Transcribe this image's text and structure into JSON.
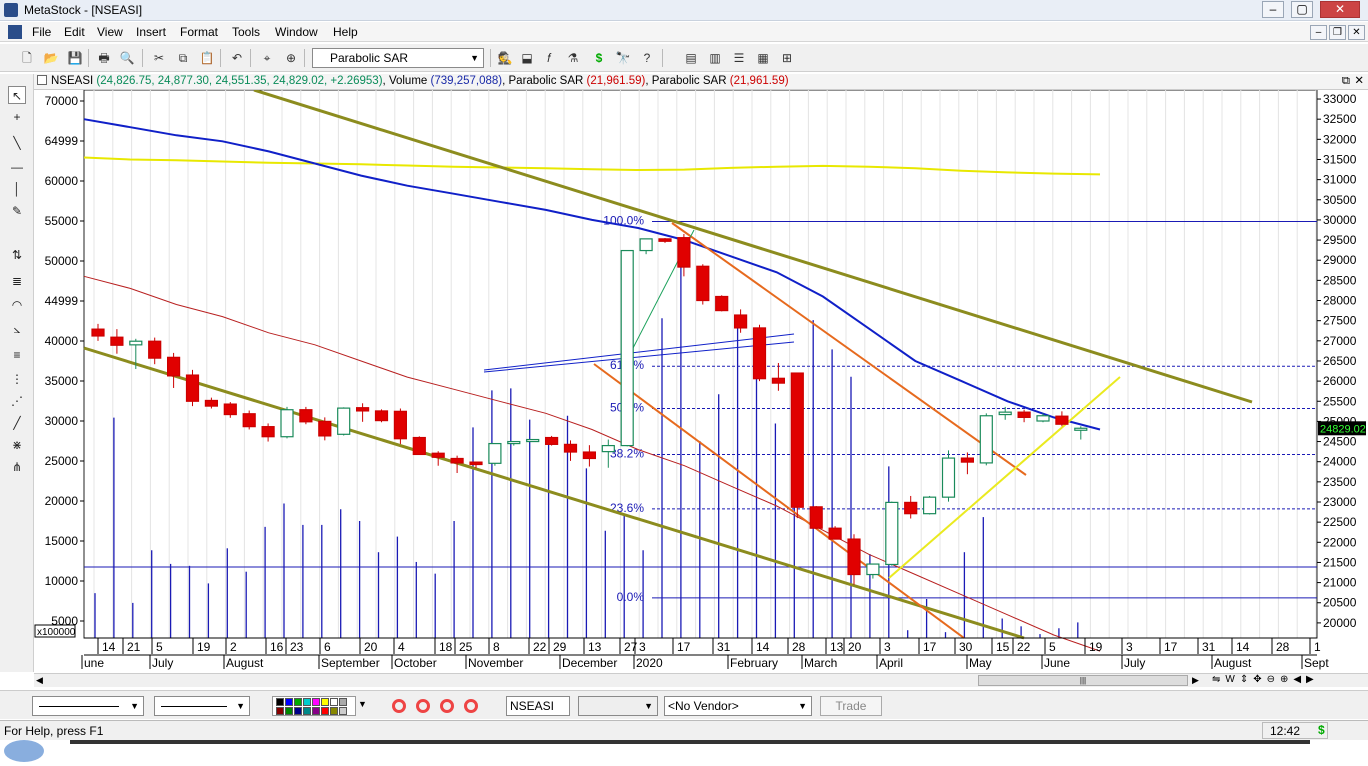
{
  "app": {
    "title": "MetaStock - [NSEASI]"
  },
  "menu": [
    "File",
    "Edit",
    "View",
    "Insert",
    "Format",
    "Tools",
    "Window",
    "Help"
  ],
  "toolbar": {
    "indicator_select": "Parabolic SAR"
  },
  "header": {
    "symbol": "NSEASI",
    "ohlc": "(24,826.75, 24,877.30, 24,551.35, 24,829.02, +2.26953)",
    "volume_label": "Volume",
    "volume_value": "(739,257,088)",
    "sar1_label": "Parabolic SAR",
    "sar1_value": "(21,961.59)",
    "sar2_label": "Parabolic SAR",
    "sar2_value": "(21,961.59)"
  },
  "chart_data": {
    "type": "candlestick",
    "left_axis": {
      "ticks": [
        "70000",
        "64999",
        "60000",
        "55000",
        "50000",
        "44999",
        "40000",
        "35000",
        "30000",
        "25000",
        "20000",
        "15000",
        "10000",
        "5000"
      ],
      "multiplier": "x100000"
    },
    "right_axis": {
      "ticks": [
        "33000",
        "32500",
        "32000",
        "31500",
        "31000",
        "30500",
        "30000",
        "29500",
        "29000",
        "28500",
        "28000",
        "27500",
        "27000",
        "26500",
        "26000",
        "25500",
        "25000",
        "24500",
        "24000",
        "23500",
        "23000",
        "22500",
        "22000",
        "21500",
        "21000",
        "20500",
        "20000"
      ],
      "ylim": [
        19625,
        33125
      ]
    },
    "last_price": "24829.02",
    "fib_labels": [
      {
        "label": "100.0%",
        "price": 29960
      },
      {
        "label": "61.8%",
        "price": 26370
      },
      {
        "label": "50.0%",
        "price": 25320
      },
      {
        "label": "38.2%",
        "price": 24180
      },
      {
        "label": "23.6%",
        "price": 22830
      },
      {
        "label": "0.0%",
        "price": 20620
      }
    ],
    "x_day_labels": [
      "14",
      "21",
      "5",
      "19",
      "2",
      "16",
      "23",
      "6",
      "20",
      "4",
      "18",
      "25",
      "8",
      "22",
      "29",
      "13",
      "27",
      "3",
      "17",
      "31",
      "14",
      "28",
      "13",
      "20",
      "3",
      "17",
      "30",
      "15",
      "22",
      "5",
      "19",
      "3",
      "17",
      "31",
      "14",
      "28",
      "1"
    ],
    "x_month_labels": [
      "une",
      "July",
      "August",
      "September",
      "October",
      "November",
      "December",
      "2020",
      "February",
      "March",
      "April",
      "May",
      "June",
      "July",
      "August",
      "Sept"
    ],
    "candles": [
      {
        "o": 27290,
        "h": 27420,
        "c": 27120,
        "l": 27000
      },
      {
        "o": 27090,
        "h": 27290,
        "c": 26890,
        "l": 26680
      },
      {
        "o": 26900,
        "h": 27050,
        "c": 26990,
        "l": 26300
      },
      {
        "o": 26990,
        "h": 27080,
        "c": 26570,
        "l": 26420
      },
      {
        "o": 26590,
        "h": 26700,
        "c": 26130,
        "l": 25830
      },
      {
        "o": 26150,
        "h": 26280,
        "c": 25500,
        "l": 25380
      },
      {
        "o": 25520,
        "h": 25590,
        "c": 25380,
        "l": 25320
      },
      {
        "o": 25430,
        "h": 25480,
        "c": 25170,
        "l": 25090
      },
      {
        "o": 25190,
        "h": 25270,
        "c": 24870,
        "l": 24800
      },
      {
        "o": 24870,
        "h": 24950,
        "c": 24620,
        "l": 24500
      },
      {
        "o": 24620,
        "h": 25360,
        "c": 25290,
        "l": 24580
      },
      {
        "o": 25290,
        "h": 25360,
        "c": 24990,
        "l": 24930
      },
      {
        "o": 25000,
        "h": 25100,
        "c": 24640,
        "l": 24530
      },
      {
        "o": 24680,
        "h": 25350,
        "c": 25330,
        "l": 24650
      },
      {
        "o": 25340,
        "h": 25450,
        "c": 25260,
        "l": 24990
      },
      {
        "o": 25260,
        "h": 25300,
        "c": 25020,
        "l": 24980
      },
      {
        "o": 25250,
        "h": 25320,
        "c": 24570,
        "l": 24440
      },
      {
        "o": 24600,
        "h": 24630,
        "c": 24180,
        "l": 24180
      },
      {
        "o": 24210,
        "h": 24260,
        "c": 24110,
        "l": 23900
      },
      {
        "o": 24080,
        "h": 24150,
        "c": 23970,
        "l": 23720
      },
      {
        "o": 23990,
        "h": 24000,
        "c": 23930,
        "l": 23840
      },
      {
        "o": 23960,
        "h": 24390,
        "c": 24450,
        "l": 23900
      },
      {
        "o": 24450,
        "h": 24510,
        "c": 24500,
        "l": 24400
      },
      {
        "o": 24530,
        "h": 24560,
        "c": 24550,
        "l": 24490
      },
      {
        "o": 24600,
        "h": 24640,
        "c": 24430,
        "l": 24400
      },
      {
        "o": 24430,
        "h": 24530,
        "c": 24240,
        "l": 24020
      },
      {
        "o": 24240,
        "h": 24410,
        "c": 24080,
        "l": 23880
      },
      {
        "o": 24250,
        "h": 24550,
        "c": 24400,
        "l": 23850
      },
      {
        "o": 24400,
        "h": 28720,
        "c": 29240,
        "l": 24380
      },
      {
        "o": 29240,
        "h": 29420,
        "c": 29530,
        "l": 29150
      },
      {
        "o": 29530,
        "h": 29550,
        "c": 29470,
        "l": 29430
      },
      {
        "o": 29560,
        "h": 29650,
        "c": 28830,
        "l": 28600
      },
      {
        "o": 28850,
        "h": 28900,
        "c": 28000,
        "l": 27900
      },
      {
        "o": 28100,
        "h": 28130,
        "c": 27750,
        "l": 27730
      },
      {
        "o": 27640,
        "h": 27780,
        "c": 27320,
        "l": 27200
      },
      {
        "o": 27320,
        "h": 27400,
        "c": 26060,
        "l": 26000
      },
      {
        "o": 26070,
        "h": 26450,
        "c": 25950,
        "l": 25760
      },
      {
        "o": 26200,
        "h": 26200,
        "c": 22870,
        "l": 22600
      },
      {
        "o": 22880,
        "h": 22900,
        "c": 22350,
        "l": 22330
      },
      {
        "o": 22350,
        "h": 22400,
        "c": 22080,
        "l": 22070
      },
      {
        "o": 22080,
        "h": 22200,
        "c": 21200,
        "l": 20950
      },
      {
        "o": 21200,
        "h": 21470,
        "c": 21460,
        "l": 21100
      },
      {
        "o": 21450,
        "h": 23010,
        "c": 22990,
        "l": 21420
      },
      {
        "o": 22990,
        "h": 23150,
        "c": 22710,
        "l": 22590
      },
      {
        "o": 22710,
        "h": 23150,
        "c": 23120,
        "l": 22690
      },
      {
        "o": 23120,
        "h": 24280,
        "c": 24090,
        "l": 23010
      },
      {
        "o": 24090,
        "h": 24230,
        "c": 23990,
        "l": 23690
      },
      {
        "o": 23970,
        "h": 25200,
        "c": 25140,
        "l": 23910
      },
      {
        "o": 25170,
        "h": 25360,
        "c": 25230,
        "l": 25040
      },
      {
        "o": 25230,
        "h": 25290,
        "c": 25100,
        "l": 24980
      },
      {
        "o": 25010,
        "h": 25200,
        "c": 25140,
        "l": 24980
      },
      {
        "o": 25130,
        "h": 25250,
        "c": 24930,
        "l": 24880
      },
      {
        "o": 24830,
        "h": 24880,
        "c": 24830,
        "l": 24550
      }
    ],
    "volume": [
      2.3,
      11.3,
      1.8,
      4.5,
      3.8,
      3.7,
      2.8,
      4.6,
      3.4,
      5.7,
      6.9,
      5.8,
      5.8,
      6.6,
      6.0,
      4.4,
      5.2,
      3.9,
      3.3,
      6.0,
      10.8,
      12.7,
      12.8,
      11.2,
      10.1,
      11.4,
      8.7,
      5.5,
      6.3,
      4.5,
      16.4,
      19.8,
      10.1,
      12.5,
      16.4,
      15.7,
      11.0,
      11.1,
      16.3,
      14.8,
      13.4,
      4.3,
      8.8,
      0.4,
      2.0,
      0.3,
      4.4,
      6.2,
      1.0,
      0.6,
      0.2,
      0.5,
      0.8
    ],
    "moving_average_yellow": [
      31550,
      31500,
      31480,
      31450,
      31420,
      31400,
      31380,
      31350,
      31320,
      31300,
      31280,
      31260,
      31240,
      31250,
      31290,
      31320,
      31340,
      31320,
      31280,
      31220,
      31180,
      31150,
      31130
    ],
    "moving_average_blue": [
      32500,
      32300,
      32100,
      31950,
      31700,
      31400,
      31100,
      30850,
      30650,
      30450,
      30250,
      30000,
      29800,
      29500,
      29100,
      28700,
      28100,
      27300,
      26500,
      26000,
      25500,
      25100,
      24800
    ],
    "moving_average_red": [
      28600,
      28300,
      27900,
      27600,
      27200,
      26900,
      26500,
      26100,
      25800,
      25500,
      25200,
      24800,
      24300,
      23900,
      23400,
      22900,
      22300,
      21700,
      21200,
      20700,
      20200,
      19700,
      19300
    ]
  },
  "bottombar": {
    "symbol_field": "NSEASI",
    "vendor": "<No Vendor>",
    "trade_button": "Trade"
  },
  "status": {
    "help": "For Help, press F1",
    "clock": "12:42"
  }
}
